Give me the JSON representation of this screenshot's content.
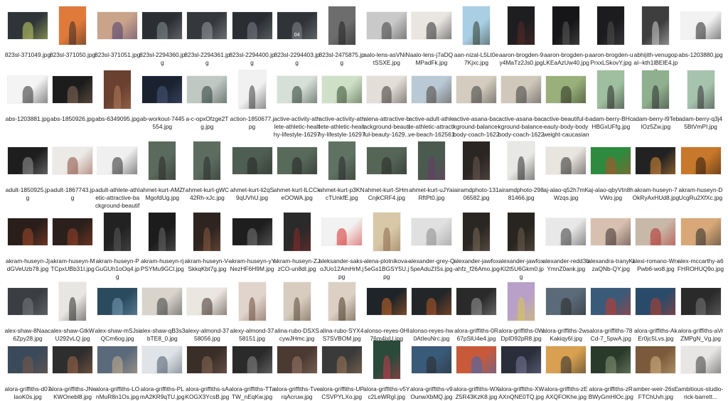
{
  "files": [
    {
      "name": "823sl-371049.jpg",
      "orient": "landscape",
      "bg": "#2e3438",
      "fg": "#c7d36a"
    },
    {
      "name": "823sl-371050.jpg",
      "orient": "portrait",
      "bg": "#e07a3a",
      "fg": "#3a2a24"
    },
    {
      "name": "823sl-371051.jpg",
      "orient": "landscape",
      "bg": "#c9a48a",
      "fg": "#4b3b6e"
    },
    {
      "name": "823sl-2294360.jpg",
      "orient": "landscape",
      "bg": "#2b2f33",
      "fg": "#8b8f94"
    },
    {
      "name": "823sl-2294361.jpg",
      "orient": "landscape",
      "bg": "#34383c",
      "fg": "#9a9ea3"
    },
    {
      "name": "823sl-2294400.jpg",
      "orient": "landscape",
      "bg": "#2a2e32",
      "fg": "#7d8288"
    },
    {
      "name": "823sl-2294403.jpg",
      "orient": "landscape",
      "bg": "#303438",
      "fg": "#868b90",
      "overlay": "04"
    },
    {
      "name": "823sl-2475875.jpg",
      "orient": "portrait",
      "bg": "#6d6d6d",
      "fg": "#222222"
    },
    {
      "name": "aalo-lens-asVNiNtSSXE.jpg",
      "orient": "landscape",
      "bg": "#c9c9c9",
      "fg": "#3a3a3a"
    },
    {
      "name": "aalo-lens-j7aDQMPadFk.jpg",
      "orient": "landscape",
      "bg": "#e9e6e2",
      "fg": "#2b2b2b"
    },
    {
      "name": "aan-nizal-L5Lt0e7Kjxc.jpg",
      "orient": "portrait",
      "bg": "#a9cfe5",
      "fg": "#2e3a2c"
    },
    {
      "name": "aaron-brogden-9y4MaTz2Js0.jpg",
      "orient": "portrait",
      "bg": "#1e1e20",
      "fg": "#5a2a2a"
    },
    {
      "name": "aaron-brogden-pLKEaAzUw40.jpg",
      "orient": "portrait",
      "bg": "#161618",
      "fg": "#5c5c5c"
    },
    {
      "name": "aaron-brogden-uPrxxLSkovY.jpg",
      "orient": "portrait",
      "bg": "#1c1c1e",
      "fg": "#505050"
    },
    {
      "name": "abhijith-venugopal--kth1lBElE4.jpg",
      "orient": "portrait",
      "bg": "#3e3e3e",
      "fg": "#d0d0d0"
    },
    {
      "name": "abs-1203880.jpg",
      "orient": "landscape",
      "bg": "#f2f2f2",
      "fg": "#222222"
    },
    {
      "name": "abs-1203881.jpg",
      "orient": "landscape",
      "bg": "#f4f4f4",
      "fg": "#2b2b2b"
    },
    {
      "name": "abs-1850926.jpg",
      "orient": "landscape",
      "bg": "#1c1c1c",
      "fg": "#8a6e5a"
    },
    {
      "name": "abs-6349095.jpg",
      "orient": "portrait",
      "bg": "#6a4030",
      "fg": "#b27a5a"
    },
    {
      "name": "ab-workout-7445554.jpg",
      "orient": "landscape",
      "bg": "#1a2230",
      "fg": "#4a5a7a"
    },
    {
      "name": "a-c-opxOfzge2Tg.jpg",
      "orient": "landscape",
      "bg": "#c0c8c4",
      "fg": "#2a3a34"
    },
    {
      "name": "action-1850677.jpg",
      "orient": "portrait",
      "bg": "#f1f1f1",
      "fg": "#3a3a3a"
    },
    {
      "name": "active-activity-athlete-athletic-healthy-lifestyle-1629725.jpg",
      "orient": "landscape",
      "bg": "#d6dfd8",
      "fg": "#2c3a30"
    },
    {
      "name": "active-activity-athlete-athletic-healthy-lifestyle-1629726.jpg",
      "orient": "landscape",
      "bg": "#cfe0c8",
      "fg": "#344a2a"
    },
    {
      "name": "alena-attractive-background-beautiful-beauty-1629...",
      "orient": "landscape",
      "bg": "#e3ded8",
      "fg": "#3a3430"
    },
    {
      "name": "active-adult-athlete-athletic-attractive-beach-1625618.jpg",
      "orient": "landscape",
      "bg": "#b9c9d5",
      "fg": "#4a4038"
    },
    {
      "name": "active-asana-background-balance-body-coach-1622691.jpg",
      "orient": "landscape",
      "bg": "#d4ccbe",
      "fg": "#3a3a3a"
    },
    {
      "name": "active-asana-background-balance-body-coach-1622692.jpg",
      "orient": "landscape",
      "bg": "#d0c8ba",
      "fg": "#3e3e3e"
    },
    {
      "name": "active-beautiful-beauty-body-bodyweight-caucasian-162971...",
      "orient": "landscape",
      "bg": "#9ab07a",
      "fg": "#2a3020"
    },
    {
      "name": "adam-berry-BHcHBGxUFfg.jpg",
      "orient": "portrait",
      "bg": "#9fbfa0",
      "fg": "#2a2a2a"
    },
    {
      "name": "adam-berry-l9TeblOz5Zw.jpg",
      "orient": "portrait",
      "bg": "#8fb08e",
      "fg": "#2e2e2e"
    },
    {
      "name": "adam-berry-q3j45BtVmPI.jpg",
      "orient": "portrait",
      "bg": "#a6c3ae",
      "fg": "#333333"
    },
    {
      "name": "adult-1850925.jpg",
      "orient": "landscape",
      "bg": "#1e1e1e",
      "fg": "#9a9a9a"
    },
    {
      "name": "adult-1867743.jpg",
      "orient": "landscape",
      "bg": "#eceae6",
      "fg": "#8a4a3a"
    },
    {
      "name": "adult-athlete-athletic-attractive-background-beautiful-1678...",
      "orient": "landscape",
      "bg": "#f0f0f0",
      "fg": "#2a2a2a"
    },
    {
      "name": "ahmet-kurt-AMZfMgofdUg.jpg",
      "orient": "portrait",
      "bg": "#5a6a5c",
      "fg": "#2a2a2a"
    },
    {
      "name": "ahmet-kurt-gWC42Rh-xJc.jpg",
      "orient": "portrait",
      "bg": "#5c6d60",
      "fg": "#2c2c2c"
    },
    {
      "name": "ahmet-kurt-li2qS9qUVhU.jpg",
      "orient": "landscape",
      "bg": "#4e5e52",
      "fg": "#262626"
    },
    {
      "name": "ahmet-kurt-lLCCkeOOWA.jpg",
      "orient": "landscape",
      "bg": "#586a5a",
      "fg": "#242424"
    },
    {
      "name": "ahmet-kurt-p3KNcTUnkfE.jpg",
      "orient": "portrait",
      "bg": "#607262",
      "fg": "#2a2a2a"
    },
    {
      "name": "ahmet-kurt-SHmCnjkCRF4.jpg",
      "orient": "landscape",
      "bg": "#556656",
      "fg": "#282828"
    },
    {
      "name": "ahmet-kurt-uJYaiRftPt0.jpg",
      "orient": "portrait",
      "bg": "#4a5a4e",
      "fg": "#6a3a6a"
    },
    {
      "name": "airamdphoto-13106582.jpg",
      "orient": "portrait",
      "bg": "#2a2624",
      "fg": "#6a5a50"
    },
    {
      "name": "airamdphoto-29881466.jpg",
      "orient": "portrait",
      "bg": "#e8e8e6",
      "fg": "#2a2a2a"
    },
    {
      "name": "aj-alao-q52h7mKWzqs.jpg",
      "orient": "landscape",
      "bg": "#e8e4de",
      "fg": "#2a2a2a"
    },
    {
      "name": "aj-alao-qbyVtn8hVWo.jpg",
      "orient": "landscape",
      "bg": "#2e8a3e",
      "fg": "#b8502a"
    },
    {
      "name": "akram-huseyn-7OkRyAxHUd8.jpg",
      "orient": "landscape",
      "bg": "#222222",
      "fg": "#e0903a"
    },
    {
      "name": "akram-huseyn-DUcgRu2XfXc.jpg",
      "orient": "landscape",
      "bg": "#c8782a",
      "fg": "#2a1a10"
    },
    {
      "name": "akram-huseyn-JjdGVeUzb78.jpg",
      "orient": "landscape",
      "bg": "#2a1e1a",
      "fg": "#a04a2a"
    },
    {
      "name": "akram-huseyn-MTCpxUBb31I.jpg",
      "orient": "landscape",
      "bg": "#2c201c",
      "fg": "#9a4428"
    },
    {
      "name": "akram-huseyn-PGuGUh1oOq4.jpg",
      "orient": "portrait",
      "bg": "#222222",
      "fg": "#5a5a5a"
    },
    {
      "name": "akram-huseyn-rjPSYMu9GCl.jpg",
      "orient": "portrait",
      "bg": "#1c1c1c",
      "fg": "#6a6a6a"
    },
    {
      "name": "akram-huseyn-V-SkkqKbt7g.jpg",
      "orient": "portrait",
      "bg": "#2e2420",
      "fg": "#8a5a40"
    },
    {
      "name": "akram-huseyn-yYNezHF6H9M.jpg",
      "orient": "landscape",
      "bg": "#1e1e1e",
      "fg": "#7a7a7a"
    },
    {
      "name": "akram-huseyn-ZJzCO-un8dI.jpg",
      "orient": "portrait",
      "bg": "#2a2a2a",
      "fg": "#8a2a2a"
    },
    {
      "name": "aleksander-saks-oJUo12AmHrM.jpg",
      "orient": "landscape",
      "bg": "#f2f2f2",
      "fg": "#d62a2a"
    },
    {
      "name": "alena-plotnikova-5eGs1BGSY5U.jpg",
      "orient": "portrait",
      "bg": "#d8c8a8",
      "fg": "#8a6a4a"
    },
    {
      "name": "alexander-grey-Q5peAduZISs.jpg",
      "orient": "landscape",
      "bg": "#e0e0e0",
      "fg": "#8a8a8a"
    },
    {
      "name": "alexander-jawfox-ahfz_f26Amo.jpg",
      "orient": "portrait",
      "bg": "#2a2622",
      "fg": "#7a6a5a"
    },
    {
      "name": "alexander-jawfox-Kl2t5U6Gkm0.jpg",
      "orient": "portrait",
      "bg": "#28241f",
      "fg": "#6e5e4e"
    },
    {
      "name": "alexander-redd3bYmnZ0ank.jpg",
      "orient": "landscape",
      "bg": "#e8e8e8",
      "fg": "#3a3a3a"
    },
    {
      "name": "alexandra-tranyKlzaQNb-QY.jpg",
      "orient": "landscape",
      "bg": "#d8c0b0",
      "fg": "#3a2a2a"
    },
    {
      "name": "alexi-romano-WrxPwb6-wo8.jpg",
      "orient": "landscape",
      "bg": "#c8b8a8",
      "fg": "#b02a2a"
    },
    {
      "name": "alex-mccarthy-a6FHROHUQ9o.jpg",
      "orient": "landscape",
      "bg": "#d8a878",
      "fg": "#2a2a2a"
    },
    {
      "name": "alex-shaw-8Naac6Zpy28.jpg",
      "orient": "landscape",
      "bg": "#3a3e42",
      "fg": "#7a7e82"
    },
    {
      "name": "alex-shaw-GtkWU292vLQ.jpg",
      "orient": "portrait",
      "bg": "#e8e6e2",
      "fg": "#2a2a2a"
    },
    {
      "name": "alex-shaw-mSJsiQCm6og.jpg",
      "orient": "landscape",
      "bg": "#2a4a5e",
      "fg": "#7aa0b8"
    },
    {
      "name": "alex-shaw-qB3s3bTE8_0.jpg",
      "orient": "landscape",
      "bg": "#d8d4cc",
      "fg": "#3a3a3a"
    },
    {
      "name": "alexy-almond-3758056.jpg",
      "orient": "landscape",
      "bg": "#ece6e0",
      "fg": "#3a3028"
    },
    {
      "name": "alexy-almond-3758151.jpg",
      "orient": "portrait",
      "bg": "#e0d4cc",
      "fg": "#6a4a3a"
    },
    {
      "name": "alina-rubo-DSXScywJHmc.jpg",
      "orient": "portrait",
      "bg": "#d8ccc0",
      "fg": "#5a4a3a"
    },
    {
      "name": "alina-rubo-SYX4S7SVBOM.jpg",
      "orient": "portrait",
      "bg": "#dcd0c4",
      "fg": "#4a3a2a"
    },
    {
      "name": "alonso-reyes-0Hl76m4jxU.jpg",
      "orient": "landscape",
      "bg": "#1e2428",
      "fg": "#c86a2a"
    },
    {
      "name": "alonso-reyes-hw0AtIeuNrc.jpg",
      "orient": "landscape",
      "bg": "#222628",
      "fg": "#b85a2a"
    },
    {
      "name": "alora-griffiths-0R67pSlU4e4.jpg",
      "orient": "landscape",
      "bg": "#2a2a2a",
      "fg": "#9a9a9a"
    },
    {
      "name": "alora-griffiths-0WDpID92pR8.jpg",
      "orient": "portrait",
      "bg": "#b8a0c8",
      "fg": "#d8c84a"
    },
    {
      "name": "alora-griffiths-2wsKakiqy6I.jpg",
      "orient": "landscape",
      "bg": "#5a6a78",
      "fg": "#2a2a2a"
    },
    {
      "name": "alora-griffiths-78Cd-7_5pwA.jpg",
      "orient": "landscape",
      "bg": "#3a5a7a",
      "fg": "#c83a2a"
    },
    {
      "name": "alora-griffiths-AkEr0jc5Lvs.jpg",
      "orient": "landscape",
      "bg": "#2a4a6a",
      "fg": "#b8402a"
    },
    {
      "name": "alora-griffiths-aVrZMPgN_Vg.jpg",
      "orient": "landscape",
      "bg": "#2a2a2a",
      "fg": "#7a7a7a"
    },
    {
      "name": "alora-griffiths-d07IaoK0s.jpg",
      "orient": "landscape",
      "bg": "#3a4a5a",
      "fg": "#7a5a4a"
    },
    {
      "name": "alora-griffiths-JNeKWOnebl8.jpg",
      "orient": "landscape",
      "bg": "#2e2e2e",
      "fg": "#a06a4a"
    },
    {
      "name": "alora-griffiths-LOnMuR8n1Os.jpg",
      "orient": "landscape",
      "bg": "#5a6a7a",
      "fg": "#c8b090"
    },
    {
      "name": "alora-griffiths-PLmA2KR9qTU.jpg",
      "orient": "landscape",
      "bg": "#e0e4e8",
      "fg": "#4a5a6a"
    },
    {
      "name": "alora-griffiths-sAKOGX3YcsB.jpg",
      "orient": "landscape",
      "bg": "#3a2e28",
      "fg": "#8a6a5a"
    },
    {
      "name": "alora-griffiths-TTaTW_nEqKw.jpg",
      "orient": "landscape",
      "bg": "#2a2a2a",
      "fg": "#8a8a8a"
    },
    {
      "name": "alora-griffiths-TverqAcruw.jpg",
      "orient": "landscape",
      "bg": "#4a3a32",
      "fg": "#9a7a6a"
    },
    {
      "name": "alora-griffiths-UPCSVPYLXo.jpg",
      "orient": "landscape",
      "bg": "#3a3a3a",
      "fg": "#a07a5a"
    },
    {
      "name": "alora-griffiths-v5Yc2LeWRgI.jpg",
      "orient": "portrait",
      "bg": "#2a4a3a",
      "fg": "#c83a4a"
    },
    {
      "name": "alora-griffiths-v9OunwXbMQ.jpg",
      "orient": "landscape",
      "bg": "#3a5a7a",
      "fg": "#2a2a2a"
    },
    {
      "name": "alora-griffiths-WXZ5R43KzK8.jpg",
      "orient": "landscape",
      "bg": "#c85a3a",
      "fg": "#3a6ab8"
    },
    {
      "name": "alora-griffiths-XWAXnQNE0TQ.jpg",
      "orient": "landscape",
      "bg": "#2a2e3a",
      "fg": "#7a7a9a"
    },
    {
      "name": "alora-griffiths-zEAXQFOKhe.jpg",
      "orient": "landscape",
      "bg": "#d8a050",
      "fg": "#2a2a2a"
    },
    {
      "name": "alora-griffiths-zRBWyGmHlOc.jpg",
      "orient": "landscape",
      "bg": "#2a3a2a",
      "fg": "#8a9a7a"
    },
    {
      "name": "amber-weir-26sEFTChUvh.jpg",
      "orient": "landscape",
      "bg": "#7a5a3a",
      "fg": "#d8b88a"
    },
    {
      "name": "ambitious-studio-rick-barrett...",
      "orient": "landscape",
      "bg": "#e8e6e4",
      "fg": "#3a3a3a"
    }
  ]
}
